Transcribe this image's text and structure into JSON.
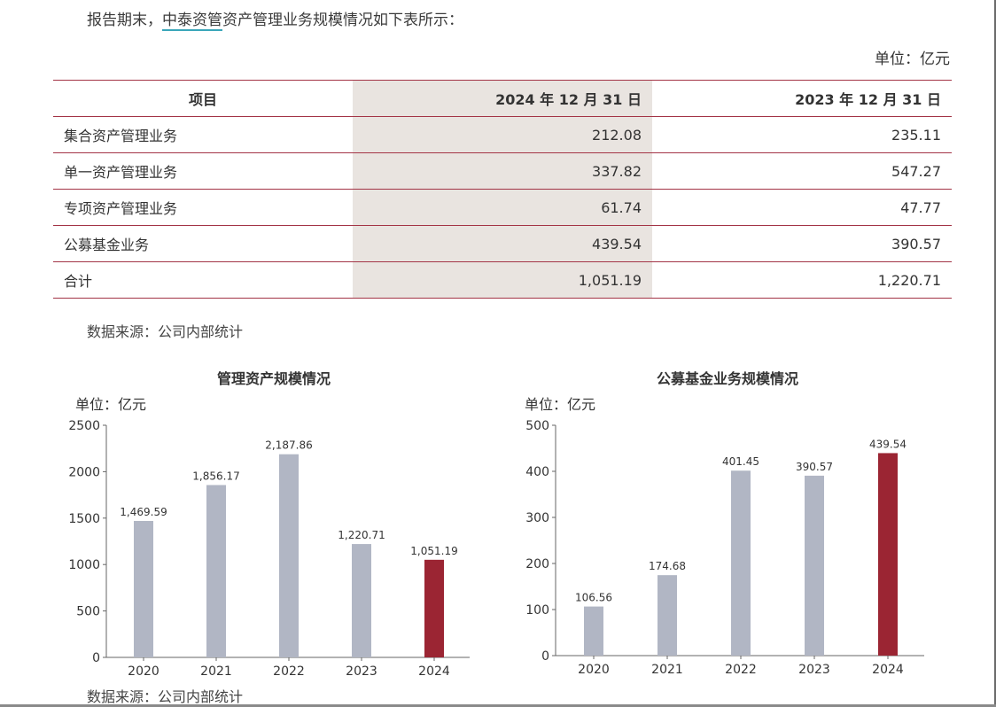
{
  "intro": {
    "prefix": "报告期末，",
    "link": "中泰资管",
    "suffix": "资产管理业务规模情况如下表所示："
  },
  "unit_top": "单位：亿元",
  "table": {
    "headers": [
      "项目",
      "2024 年 12 月 31 日",
      "2023 年 12 月 31 日"
    ],
    "rows": [
      [
        "集合资产管理业务",
        "212.08",
        "235.11"
      ],
      [
        "单一资产管理业务",
        "337.82",
        "547.27"
      ],
      [
        "专项资产管理业务",
        "61.74",
        "47.77"
      ],
      [
        "公募基金业务",
        "439.54",
        "390.57"
      ],
      [
        "合计",
        "1,051.19",
        "1,220.71"
      ]
    ]
  },
  "source_label": "数据来源：公司内部统计",
  "colors": {
    "rule": "#a33446",
    "shade": "#e9e4e0",
    "bar": "#b1b6c4",
    "highlight": "#9b2533"
  },
  "chart_data": [
    {
      "type": "bar",
      "title": "管理资产规模情况",
      "unit": "单位：亿元",
      "categories": [
        "2020",
        "2021",
        "2022",
        "2023",
        "2024"
      ],
      "values": [
        1469.59,
        1856.17,
        2187.86,
        1220.71,
        1051.19
      ],
      "labels": [
        "1,469.59",
        "1,856.17",
        "2,187.86",
        "1,220.71",
        "1,051.19"
      ],
      "ylim": [
        0,
        2500
      ],
      "yticks": [
        0,
        500,
        1000,
        1500,
        2000,
        2500
      ],
      "highlight_index": 4
    },
    {
      "type": "bar",
      "title": "公募基金业务规模情况",
      "unit": "单位：亿元",
      "categories": [
        "2020",
        "2021",
        "2022",
        "2023",
        "2024"
      ],
      "values": [
        106.56,
        174.68,
        401.45,
        390.57,
        439.54
      ],
      "labels": [
        "106.56",
        "174.68",
        "401.45",
        "390.57",
        "439.54"
      ],
      "ylim": [
        0,
        500
      ],
      "yticks": [
        0,
        100,
        200,
        300,
        400,
        500
      ],
      "highlight_index": 4
    }
  ]
}
